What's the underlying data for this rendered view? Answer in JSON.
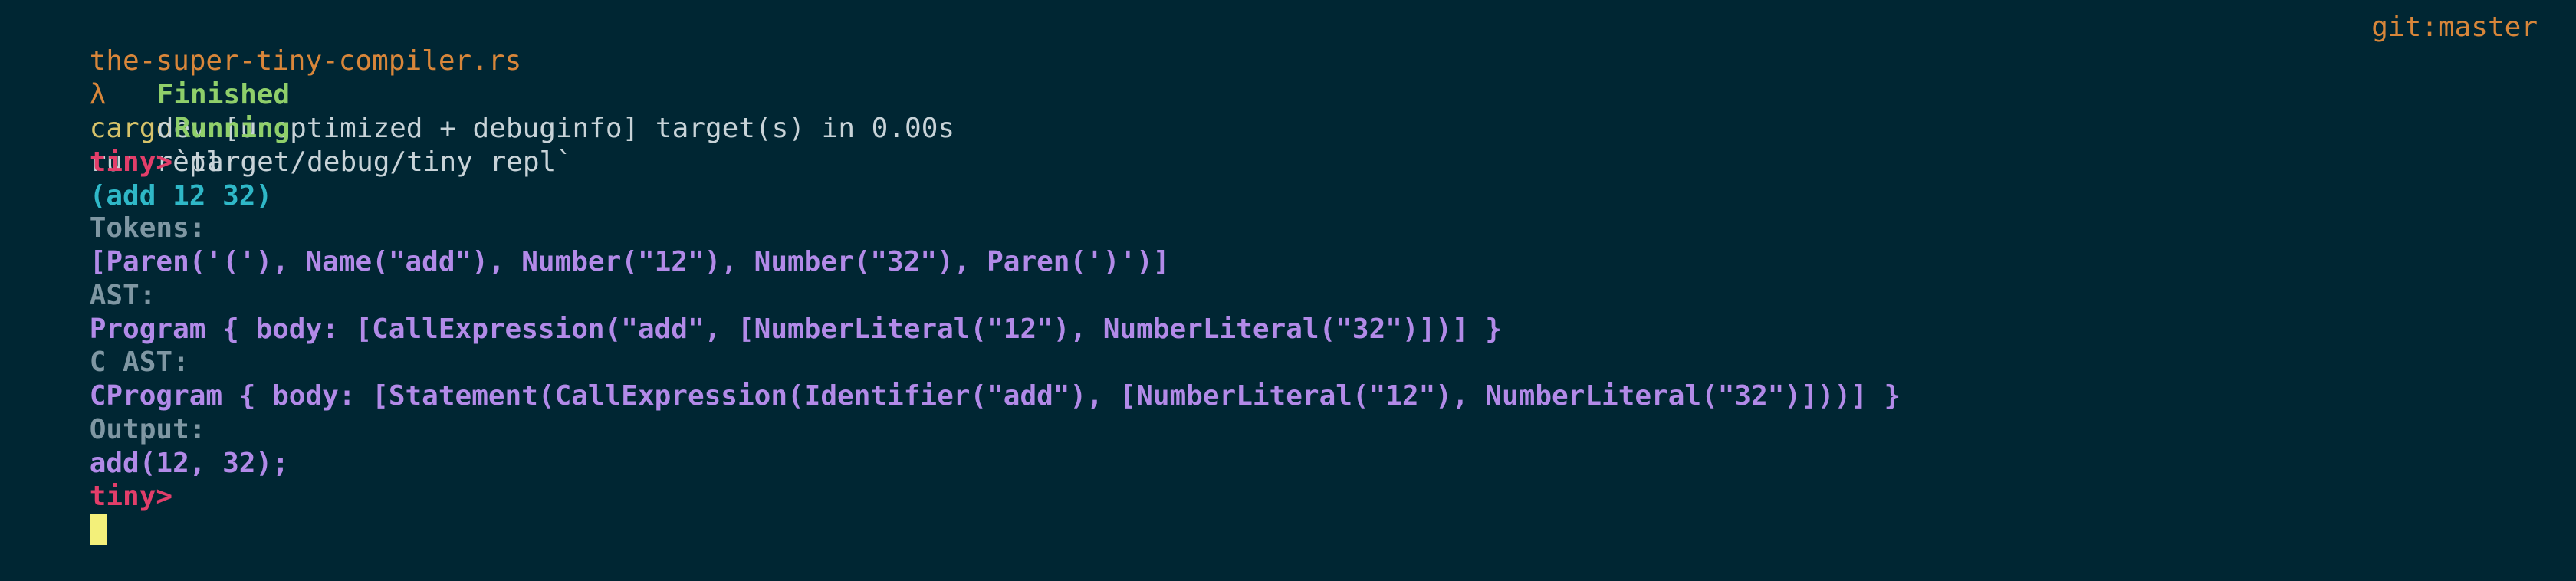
{
  "window": {
    "type": "terminal",
    "background": "#002633"
  },
  "prompt_header": {
    "directory": "the-super-tiny-compiler.rs",
    "symbol": "λ",
    "command": "cargo",
    "args": "run repl",
    "git_branch": "git:master"
  },
  "cargo_output": {
    "finished_label": "Finished",
    "finished_text": "dev [unoptimized + debuginfo] target(s) in 0.00s",
    "running_label": "Running",
    "running_text": "`target/debug/tiny repl`"
  },
  "repl": {
    "prompt": "tiny>",
    "input": "(add 12 32)",
    "tokens_label": "Tokens:",
    "tokens_value": "[Paren('('), Name(\"add\"), Number(\"12\"), Number(\"32\"), Paren(')')]",
    "ast_label": "AST:",
    "ast_value": "Program { body: [CallExpression(\"add\", [NumberLiteral(\"12\"), NumberLiteral(\"32\")])] }",
    "cast_label": "C AST:",
    "cast_value": "CProgram { body: [Statement(CallExpression(Identifier(\"add\"), [NumberLiteral(\"12\"), NumberLiteral(\"32\")]))] }",
    "output_label": "Output:",
    "output_value": "add(12, 32);",
    "second_prompt": "tiny>"
  },
  "colors": {
    "directory": "#d8863a",
    "prompt": "#e23e6a",
    "input": "#2fb8c8",
    "result": "#b28ae8",
    "label": "#7f97a3",
    "cargo_status": "#8fcf6a",
    "cursor": "#f3f07a"
  }
}
